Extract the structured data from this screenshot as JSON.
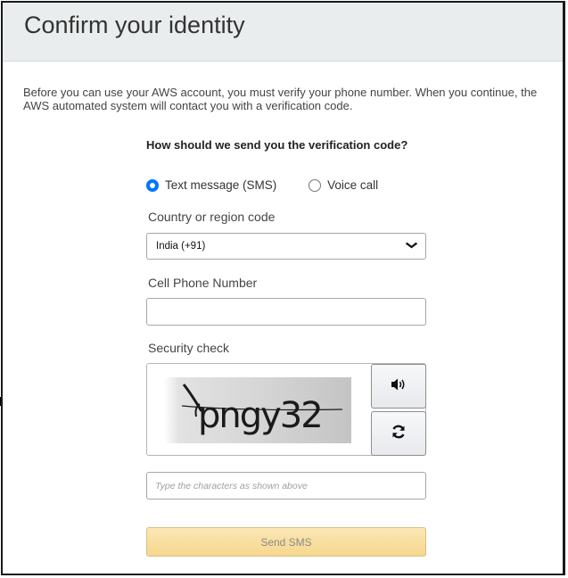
{
  "header": {
    "title": "Confirm your identity"
  },
  "intro": "Before you can use your AWS account, you must verify your phone number. When you continue, the AWS automated system will contact you with a verification code.",
  "method": {
    "question": "How should we send you the verification code?",
    "options": [
      {
        "label": "Text message (SMS)",
        "selected": true
      },
      {
        "label": "Voice call",
        "selected": false
      }
    ]
  },
  "country": {
    "label": "Country or region code",
    "value": "India (+91)"
  },
  "phone": {
    "label": "Cell Phone Number",
    "value": ""
  },
  "security": {
    "label": "Security check",
    "captcha_text": "pngy32",
    "input_placeholder": "Type the characters as shown above",
    "audio_icon": "speaker-icon",
    "refresh_icon": "refresh-icon"
  },
  "submit": {
    "label": "Send SMS"
  },
  "colors": {
    "radio_selected": "#0075ff",
    "button_gradient_top": "#fbe7b5",
    "button_gradient_bottom": "#f5d78e",
    "header_bg": "#eaeded"
  }
}
